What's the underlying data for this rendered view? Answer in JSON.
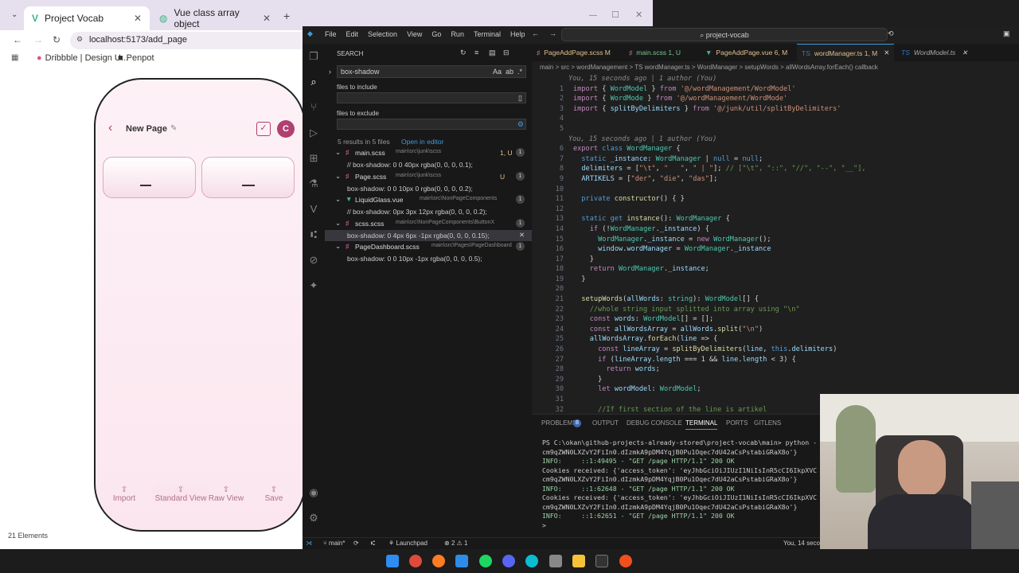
{
  "browser": {
    "tab1": "Project Vocab",
    "tab2": "Vue class array object",
    "url": "localhost:5173/add_page",
    "bookmark1": "Dribbble | Design U...",
    "bookmark2": "Penpot"
  },
  "app": {
    "page_title": "New Page",
    "avatar": "C",
    "buttons": [
      "Import",
      "Standard View",
      "Raw View",
      "Save"
    ]
  },
  "vscode": {
    "menu": [
      "File",
      "Edit",
      "Selection",
      "View",
      "Go",
      "Run",
      "Terminal",
      "Help"
    ],
    "search_box": "project-vocab",
    "search": {
      "title": "SEARCH",
      "query": "box-shadow",
      "include_label": "files to include",
      "exclude_label": "files to exclude",
      "summary": "5 results in 5 files",
      "open_editor": "Open in editor",
      "results": [
        {
          "file": "main.scss",
          "path": "main\\src\\junk\\scss",
          "badge": "1, U",
          "count": "1",
          "match": "// box-shadow: 0 0 40px rgba(0, 0, 0, 0.1);"
        },
        {
          "file": "Page.scss",
          "path": "main\\src\\junk\\scss",
          "badge": "U",
          "count": "1",
          "match": "box-shadow: 0 0 10px 0 rgba(0, 0, 0, 0.2);"
        },
        {
          "file": "LiquidGlass.vue",
          "path": "main\\src\\NonPageComponents",
          "badge": "",
          "count": "1",
          "match": "// box-shadow: 0px 3px 12px rgba(0, 0, 0, 0.2);"
        },
        {
          "file": "scss.scss",
          "path": "main\\src\\NonPageComponents\\ButtonX",
          "badge": "",
          "count": "1",
          "match": "box-shadow: 0 4px 6px -1px rgba(0, 0, 0, 0.15);"
        },
        {
          "file": "PageDashboard.scss",
          "path": "main\\src\\Pages\\PageDashboard",
          "badge": "",
          "count": "1",
          "match": "box-shadow: 0 0 10px -1px rgba(0, 0, 0, 0.5);"
        }
      ]
    },
    "tabs": [
      "PageAddPage.scss M",
      "main.scss 1, U",
      "PageAddPage.vue 6, M",
      "wordManager.ts 1, M",
      "WordModel.ts"
    ],
    "breadcrumb": "main > src > wordManagement > TS wordManager.ts > WordManager > setupWords > allWordsArray.forEach() callback",
    "blame1": "You, 15 seconds ago | 1 author (You)",
    "blame2": "You, 15 seconds ago | 1 author (You)",
    "code": [
      "import { WordModel } from '@/wordManagement/WordModel'",
      "import { WordMode } from '@/wordManagement/WordMode'",
      "import { splitByDelimiters } from '@/junk/util/splitByDelimiters'",
      "",
      "",
      "export class WordManager {",
      "  static _instance: WordManager | null = null;",
      "  delimiters = [\"\\t\", \"   \", \" | \"]; // [\"\\t\", \"::\", \"//\", \"--\", \"__\"],",
      "  ARTIKELS = [\"der\", \"die\", \"das\"];",
      "",
      "  private constructor() { }",
      "",
      "  static get instance(): WordManager {",
      "    if (!WordManager._instance) {",
      "      WordManager._instance = new WordManager();",
      "      window.wordManager = WordManager._instance",
      "    }",
      "    return WordManager._instance;",
      "  }",
      "",
      "  setupWords(allWords: string): WordModel[] {",
      "    //whole string input splitted into array using \"\\n\"",
      "    const words: WordModel[] = [];",
      "    const allWordsArray = allWords.split(\"\\n\")",
      "    allWordsArray.forEach(line => {",
      "      const lineArray = splitByDelimiters(line, this.delimiters)",
      "      if (lineArray.length === 1 && line.length < 3) {",
      "        return words;",
      "      }",
      "      let wordModel: WordModel;",
      "",
      "      //If first section of the line is artikel"
    ],
    "panel_tabs": [
      "PROBLEMS",
      "OUTPUT",
      "DEBUG CONSOLE",
      "TERMINAL",
      "PORTS",
      "GITLENS"
    ],
    "problems_count": "8",
    "terminal": [
      "PS C:\\okan\\github-projects-already-stored\\project-vocab\\main> python -",
      "cm9qZWN0LXZvY2FiIn0.dIzmkA9pDM4YqjB0Pu1Oqec7dU42aCsPstabiGRaX8o'}",
      "INFO:     ::1:49495 - \"GET /page HTTP/1.1\" 200 OK",
      "Cookies received: {'access_token': 'eyJhbGciOiJIUzI1NiIsInR5cCI6IkpXVC",
      "cm9qZWN0LXZvY2FiIn0.dIzmkA9pDM4YqjB0Pu1Oqec7dU42aCsPstabiGRaX8o'}",
      "INFO:     ::1:62648 - \"GET /page HTTP/1.1\" 200 OK",
      "Cookies received: {'access_token': 'eyJhbGciOiJIUzI1NiIsInR5cCI6IkpXVC",
      "cm9qZWN0LXZvY2FiIn0.dIzmkA9pDM4YqjB0Pu1Oqec7dU42aCsPstabiGRaX8o'}",
      "INFO:     ::1:62651 - \"GET /page HTTP/1.1\" 200 OK",
      ">"
    ],
    "status": {
      "branch": "main*",
      "launchpad": "Launchpad",
      "problems": "2 ⚠ 1",
      "blame": "You, 14 seconds"
    },
    "footer_elements": "21 Elements"
  }
}
